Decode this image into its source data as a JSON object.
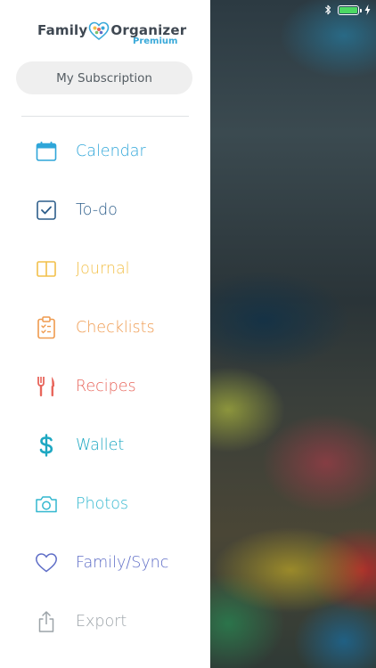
{
  "status_bar": {
    "battery_level": 1.0,
    "battery_color": "#4cd964",
    "icons": [
      "bluetooth-icon",
      "battery-icon",
      "charging-bolt-icon"
    ]
  },
  "drawer": {
    "brand": {
      "word1": "Family",
      "word2": "Organizer",
      "tier": "Premium",
      "logo_icon": "heart-logo-icon"
    },
    "subscription_button": "My Subscription",
    "items": [
      {
        "label": "Calendar",
        "icon": "calendar-icon",
        "color": "#2fa6d9"
      },
      {
        "label": "To-do",
        "icon": "checkbox-icon",
        "color": "#2c5d8a"
      },
      {
        "label": "Journal",
        "icon": "book-icon",
        "color": "#f2c04a"
      },
      {
        "label": "Checklists",
        "icon": "clipboard-check-icon",
        "color": "#ef9a4e"
      },
      {
        "label": "Recipes",
        "icon": "fork-knife-icon",
        "color": "#e8665c"
      },
      {
        "label": "Wallet",
        "icon": "dollar-icon",
        "color": "#1ea8c2"
      },
      {
        "label": "Photos",
        "icon": "camera-icon",
        "color": "#32b7cf"
      },
      {
        "label": "Family/Sync",
        "icon": "heart-icon",
        "color": "#5f6ec7"
      },
      {
        "label": "Export",
        "icon": "share-icon",
        "color": "#9ca3a8"
      }
    ]
  }
}
